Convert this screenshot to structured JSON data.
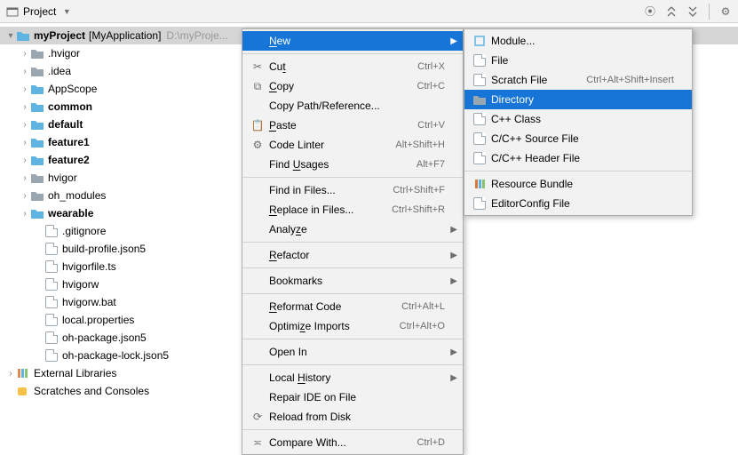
{
  "toolbar": {
    "project_label": "Project"
  },
  "tree": {
    "root": {
      "name": "myProject",
      "module": "[MyApplication]",
      "path": "D:\\myProje..."
    },
    "items": [
      {
        "depth": 1,
        "arrow": ">",
        "icon": "folder",
        "label": ".hvigor"
      },
      {
        "depth": 1,
        "arrow": ">",
        "icon": "folder",
        "label": ".idea"
      },
      {
        "depth": 1,
        "arrow": ">",
        "icon": "folder-src",
        "label": "AppScope"
      },
      {
        "depth": 1,
        "arrow": ">",
        "icon": "folder-src",
        "label": "common",
        "bold": true
      },
      {
        "depth": 1,
        "arrow": ">",
        "icon": "folder-src",
        "label": "default",
        "bold": true
      },
      {
        "depth": 1,
        "arrow": ">",
        "icon": "folder-src",
        "label": "feature1",
        "bold": true
      },
      {
        "depth": 1,
        "arrow": ">",
        "icon": "folder-src",
        "label": "feature2",
        "bold": true
      },
      {
        "depth": 1,
        "arrow": ">",
        "icon": "folder",
        "label": "hvigor"
      },
      {
        "depth": 1,
        "arrow": ">",
        "icon": "folder",
        "label": "oh_modules"
      },
      {
        "depth": 1,
        "arrow": ">",
        "icon": "folder-src",
        "label": "wearable",
        "bold": true
      },
      {
        "depth": 2,
        "arrow": "",
        "icon": "file",
        "label": ".gitignore"
      },
      {
        "depth": 2,
        "arrow": "",
        "icon": "file",
        "label": "build-profile.json5"
      },
      {
        "depth": 2,
        "arrow": "",
        "icon": "file",
        "label": "hvigorfile.ts"
      },
      {
        "depth": 2,
        "arrow": "",
        "icon": "file",
        "label": "hvigorw"
      },
      {
        "depth": 2,
        "arrow": "",
        "icon": "file",
        "label": "hvigorw.bat"
      },
      {
        "depth": 2,
        "arrow": "",
        "icon": "file",
        "label": "local.properties"
      },
      {
        "depth": 2,
        "arrow": "",
        "icon": "file",
        "label": "oh-package.json5"
      },
      {
        "depth": 2,
        "arrow": "",
        "icon": "file",
        "label": "oh-package-lock.json5"
      }
    ],
    "external": "External Libraries",
    "scratches": "Scratches and Consoles"
  },
  "ctx": [
    {
      "t": "item",
      "icon": "",
      "label": "New",
      "u": "N",
      "sub": true,
      "hl": true
    },
    {
      "t": "sep"
    },
    {
      "t": "item",
      "icon": "✂",
      "label": "Cut",
      "u": "t",
      "sc": "Ctrl+X"
    },
    {
      "t": "item",
      "icon": "⧉",
      "label": "Copy",
      "u": "C",
      "sc": "Ctrl+C"
    },
    {
      "t": "item",
      "icon": "",
      "label": "Copy Path/Reference..."
    },
    {
      "t": "item",
      "icon": "📋",
      "label": "Paste",
      "u": "P",
      "sc": "Ctrl+V"
    },
    {
      "t": "item",
      "icon": "⚙",
      "label": "Code Linter",
      "sc": "Alt+Shift+H"
    },
    {
      "t": "item",
      "icon": "",
      "label": "Find Usages",
      "u": "U",
      "sc": "Alt+F7"
    },
    {
      "t": "sep"
    },
    {
      "t": "item",
      "icon": "",
      "label": "Find in Files...",
      "sc": "Ctrl+Shift+F"
    },
    {
      "t": "item",
      "icon": "",
      "label": "Replace in Files...",
      "u": "R",
      "sc": "Ctrl+Shift+R"
    },
    {
      "t": "item",
      "icon": "",
      "label": "Analyze",
      "u": "z",
      "sub": true
    },
    {
      "t": "sep"
    },
    {
      "t": "item",
      "icon": "",
      "label": "Refactor",
      "u": "R",
      "sub": true
    },
    {
      "t": "sep"
    },
    {
      "t": "item",
      "icon": "",
      "label": "Bookmarks",
      "sub": true
    },
    {
      "t": "sep"
    },
    {
      "t": "item",
      "icon": "",
      "label": "Reformat Code",
      "u": "R",
      "sc": "Ctrl+Alt+L"
    },
    {
      "t": "item",
      "icon": "",
      "label": "Optimize Imports",
      "u": "z",
      "sc": "Ctrl+Alt+O"
    },
    {
      "t": "sep"
    },
    {
      "t": "item",
      "icon": "",
      "label": "Open In",
      "sub": true
    },
    {
      "t": "sep"
    },
    {
      "t": "item",
      "icon": "",
      "label": "Local History",
      "u": "H",
      "sub": true
    },
    {
      "t": "item",
      "icon": "",
      "label": "Repair IDE on File"
    },
    {
      "t": "item",
      "icon": "⟳",
      "label": "Reload from Disk"
    },
    {
      "t": "sep"
    },
    {
      "t": "item",
      "icon": "≍",
      "label": "Compare With...",
      "sc": "Ctrl+D"
    }
  ],
  "sub": [
    {
      "icon": "module",
      "label": "Module..."
    },
    {
      "icon": "file",
      "label": "File"
    },
    {
      "icon": "scratch",
      "label": "Scratch File",
      "sc": "Ctrl+Alt+Shift+Insert"
    },
    {
      "icon": "folder",
      "label": "Directory",
      "hl": true
    },
    {
      "icon": "cpp",
      "label": "C++ Class"
    },
    {
      "icon": "c",
      "label": "C/C++ Source File"
    },
    {
      "icon": "h",
      "label": "C/C++ Header File"
    },
    {
      "t": "sep"
    },
    {
      "icon": "bundle",
      "label": "Resource Bundle"
    },
    {
      "icon": "editorconfig",
      "label": "EditorConfig File"
    }
  ]
}
